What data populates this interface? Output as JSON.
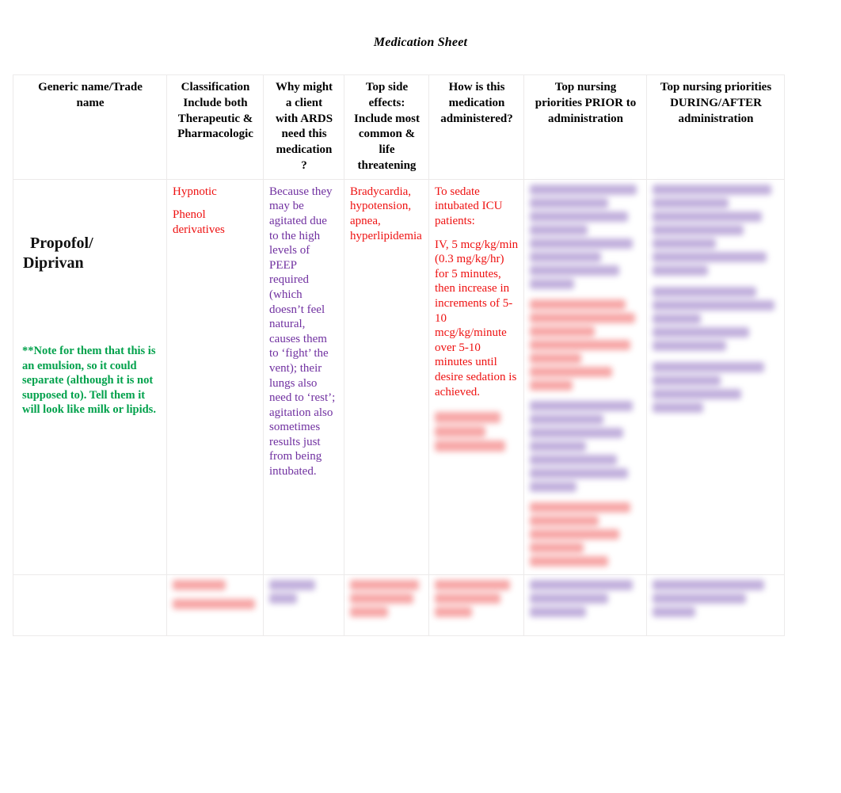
{
  "document": {
    "title": "Medication Sheet"
  },
  "table": {
    "headers": [
      "Generic name/Trade name",
      "Classification\nInclude both Therapeutic & Pharmacologic",
      "Why might a client with ARDS need this medication?",
      "Top side effects: Include most common & life threatening",
      "How is this medication administered?",
      "Top nursing priorities PRIOR to administration",
      "Top nursing priorities DURING/AFTER administration"
    ],
    "header_parts": {
      "c0_l1": "Generic name/Trade",
      "c0_l2": "name",
      "c1_l1": "Classification",
      "c1_l2": "Include both",
      "c1_l3": "Therapeutic &",
      "c1_l4": "Pharmacologic",
      "c2_l1": "Why might",
      "c2_l2": "a client",
      "c2_l3": "with ARDS",
      "c2_l4": "need this",
      "c2_l5": "medication",
      "c2_l6": "?",
      "c3_l1": "Top side",
      "c3_l2": "effects:",
      "c3_l3": "Include most",
      "c3_l4": "common &",
      "c3_l5": "life",
      "c3_l6": "threatening",
      "c4_l1": "How is this",
      "c4_l2": "medication",
      "c4_l3": "administered?",
      "c5_l1": "Top nursing",
      "c5_l2": "priorities PRIOR to",
      "c5_l3": "administration",
      "c6_l1": "Top nursing priorities",
      "c6_l2": "DURING/AFTER",
      "c6_l3": "administration"
    },
    "row": {
      "generic_name_line1": "Propofol/",
      "generic_name_line2": "Diprivan",
      "emulsion_note": "**Note for them that this is an emulsion, so it could separate (although it is not supposed to). Tell them it will look like milk or lipids.",
      "classification_therapeutic": "Hypnotic",
      "classification_pharmacologic": "Phenol derivatives",
      "why_needed": "Because they may be agitated due to the high levels of PEEP required (which doesn’t feel natural, causes them to ‘fight’ the vent); their lungs also need to ‘rest’; agitation also sometimes results just from being intubated.",
      "side_effects": "Bradycardia, hypotension, apnea, hyperlipidemia",
      "administration_indication": "To sedate intubated ICU patients:",
      "administration_dosing": "IV, 5 mcg/kg/min (0.3 mg/kg/hr) for 5 minutes, then increase in increments of 5-10 mcg/kg/minute over 5-10 minutes until desire sedation is achieved.",
      "administration_extra_obscured": "",
      "priorities_prior_obscured": "",
      "priorities_during_after_obscured": ""
    }
  },
  "colors": {
    "red": "#ee1111",
    "purple": "#7030a0",
    "green": "#00a14b",
    "black": "#000000",
    "border": "#eceaea"
  }
}
